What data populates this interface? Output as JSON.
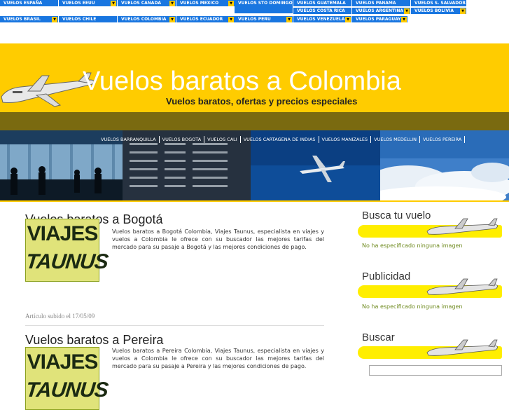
{
  "topnav": [
    {
      "label": "VUELOS ESPAÑA",
      "dd": false
    },
    {
      "label": "VUELOS EEUU",
      "dd": true
    },
    {
      "label": "VUELOS CANADA",
      "dd": true
    },
    {
      "label": "VUELOS MEXICO",
      "dd": true
    },
    {
      "label": "VUELOS STO DOMINGO",
      "dd": false
    },
    {
      "label": "VUELOS GUATEMALA",
      "dd": false
    },
    {
      "label": "VUELOS PANAMA",
      "dd": false
    },
    {
      "label": "VUELOS S. SALVADOR",
      "dd": false
    },
    {
      "label": "VUELOS COSTA RICA",
      "dd": false
    },
    {
      "label": "VUELOS ARGENTINA",
      "dd": true
    },
    {
      "label": "VUELOS BOLIVIA",
      "dd": true
    },
    {
      "label": "VUELOS BRASIL",
      "dd": true
    },
    {
      "label": "VUELOS CHILE",
      "dd": false
    },
    {
      "label": "VUELOS COLOMBIA",
      "dd": true
    },
    {
      "label": "VUELOS ECUADOR",
      "dd": true
    },
    {
      "label": "VUELOS PERU",
      "dd": true
    },
    {
      "label": "VUELOS VENEZUELA",
      "dd": true
    },
    {
      "label": "VUELOS PARAGUAY",
      "dd": true
    }
  ],
  "header": {
    "title": "Vuelos baratos a Colombia",
    "subtitle": "Vuelos baratos, ofertas y precios especiales"
  },
  "citynav": [
    "VUELOS BARRANQUILLA",
    "VUELOS BOGOTA",
    "VUELOS CALI",
    "VUELOS CARTAGENA DE INDIAS",
    "VUELOS MANIZALES",
    "VUELOS MEDELLIN",
    "VUELOS PEREIRA"
  ],
  "articles": [
    {
      "title": "Vuelos baratos a Bogotá",
      "logo1": "VIAJES",
      "logo2": "TAUNUS",
      "text": "Vuelos baratos a Bogotá Colombia, Viajes Taunus, especialista en viajes y vuelos a Colombia le ofrece con su buscador las mejores tarifas del mercado para su pasaje a Bogotá y las mejores condiciones de pago.",
      "meta": "Artículo subido el 17/05/09"
    },
    {
      "title": "Vuelos baratos a Pereira",
      "logo1": "VIAJES",
      "logo2": "TAUNUS",
      "text": "Vuelos baratos a Pereira Colombia, Viajes Taunus, especialista en viajes y vuelos a Colombia le ofrece con su buscador las mejores tarifas del mercado para su pasaje a Pereira y las mejores condiciones de pago."
    }
  ],
  "sidebar": [
    {
      "heading": "Busca tu vuelo",
      "note": "No ha especificado ninguna imagen"
    },
    {
      "heading": "Publicidad",
      "note": "No ha especificado ninguna imagen"
    },
    {
      "heading": "Buscar"
    }
  ],
  "colors": {
    "nav_blue": "#1976e0",
    "header_yellow": "#ffcc00",
    "band": "#7a6a10"
  }
}
